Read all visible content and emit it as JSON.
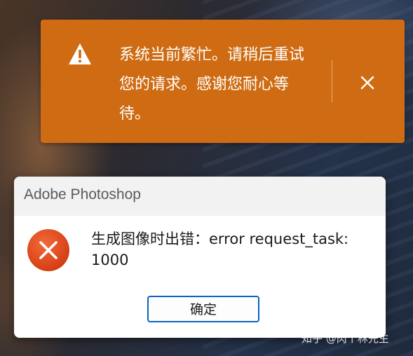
{
  "toast": {
    "message": "系统当前繁忙。请稍后重试您的请求。感谢您耐心等待。",
    "icon": "warning-icon",
    "close_icon": "close-icon",
    "background_color": "#cf6c13"
  },
  "dialog": {
    "title": "Adobe Photoshop",
    "icon": "error-icon",
    "icon_color": "#e0461a",
    "message": "生成图像时出错：error request_task: 1000",
    "ok_label": "确定",
    "button_border_color": "#0b62c4"
  },
  "watermark": {
    "text": "知乎 @肉个林先生"
  }
}
